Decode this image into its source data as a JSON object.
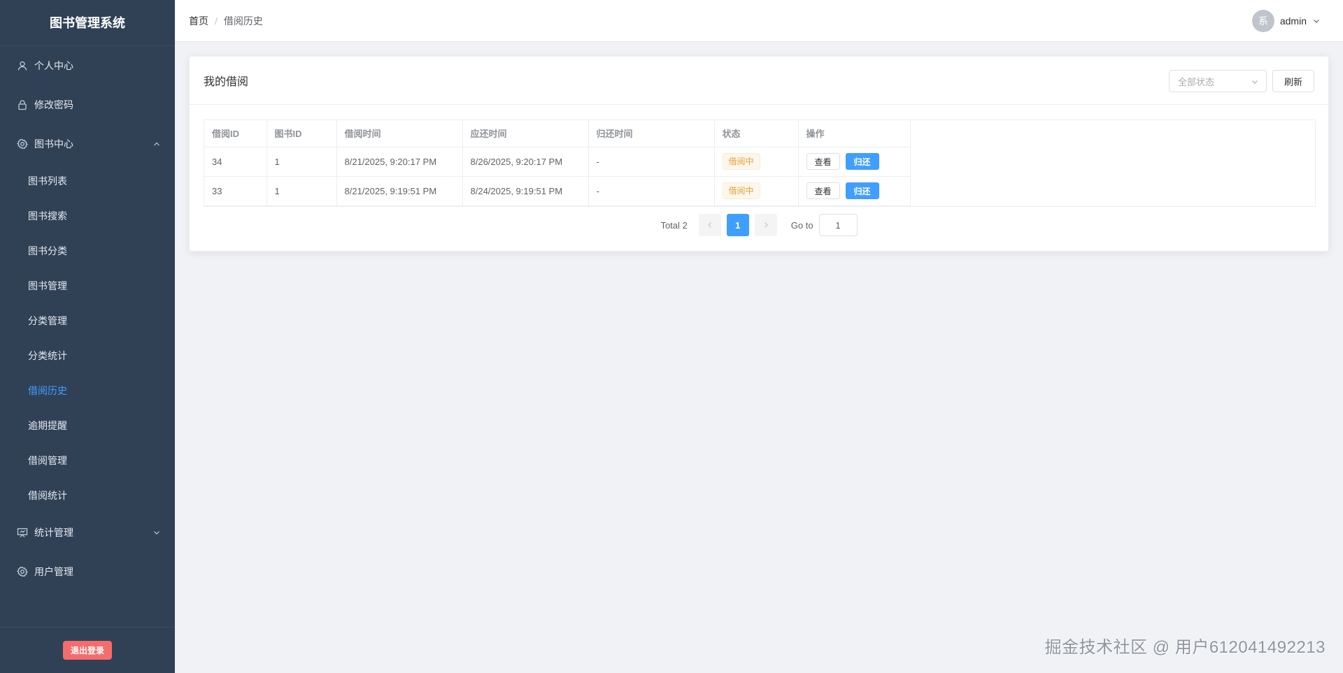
{
  "sidebar": {
    "title": "图书管理系统",
    "items": [
      {
        "label": "个人中心",
        "icon": "user-icon"
      },
      {
        "label": "修改密码",
        "icon": "lock-icon"
      },
      {
        "label": "图书中心",
        "icon": "gear-icon",
        "expanded": true,
        "children": [
          "图书列表",
          "图书搜索",
          "图书分类",
          "图书管理",
          "分类管理",
          "分类统计",
          "借阅历史",
          "逾期提醒",
          "借阅管理",
          "借阅统计"
        ]
      },
      {
        "label": "统计管理",
        "icon": "chart-board-icon",
        "expanded": false
      },
      {
        "label": "用户管理",
        "icon": "gear-icon"
      }
    ],
    "active_child": "借阅历史",
    "logout_label": "退出登录"
  },
  "header": {
    "breadcrumb": [
      "首页",
      "借阅历史"
    ],
    "avatar_text": "系",
    "username": "admin"
  },
  "card": {
    "title": "我的借阅",
    "status_placeholder": "全部状态",
    "refresh_label": "刷新"
  },
  "table": {
    "columns": [
      "借阅ID",
      "图书ID",
      "借阅时间",
      "应还时间",
      "归还时间",
      "状态",
      "操作"
    ],
    "rows": [
      {
        "borrow_id": "34",
        "book_id": "1",
        "borrow_time": "8/21/2025, 9:20:17 PM",
        "due_time": "8/26/2025, 9:20:17 PM",
        "return_time": "-",
        "status": "借阅中",
        "view": "查看",
        "return": "归还"
      },
      {
        "borrow_id": "33",
        "book_id": "1",
        "borrow_time": "8/21/2025, 9:19:51 PM",
        "due_time": "8/24/2025, 9:19:51 PM",
        "return_time": "-",
        "status": "借阅中",
        "view": "查看",
        "return": "归还"
      }
    ]
  },
  "pager": {
    "total_label": "Total 2",
    "current_page": "1",
    "goto_label": "Go to",
    "goto_value": "1"
  },
  "watermark": "掘金技术社区 @ 用户612041492213",
  "colors": {
    "sidebar_bg": "#304156",
    "accent": "#409eff",
    "warning": "#e6a23c",
    "danger": "#f56c6c"
  }
}
